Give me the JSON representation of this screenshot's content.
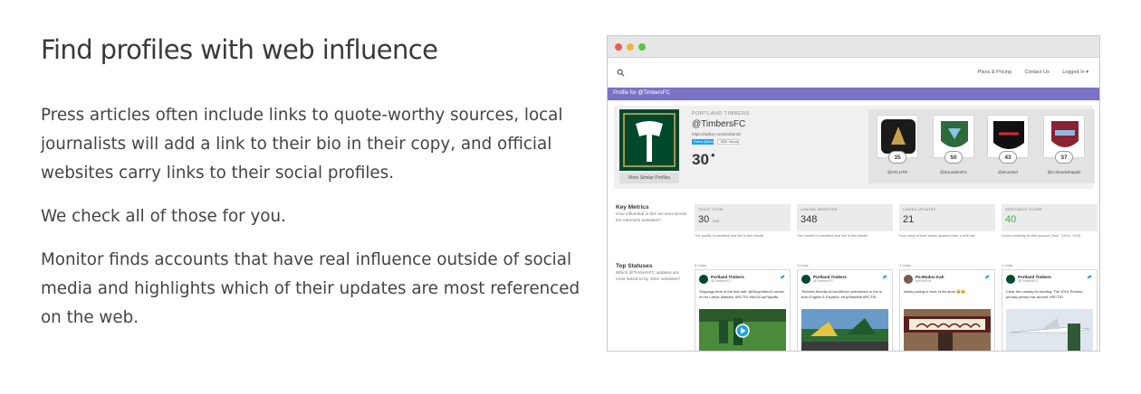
{
  "intro": {
    "title": "Find profiles with web influence",
    "paragraphs": [
      "Press articles often include links to quote-worthy sources, local journalists will add a link to their bio in their copy, and official websites carry links to their social profiles.",
      "We check all of those for you.",
      "Monitor finds accounts that have real influence outside of social media and highlights which of their updates are most referenced on the web."
    ]
  },
  "app": {
    "nav": {
      "plans": "Plans & Pricing",
      "contact": "Contact Us",
      "login": "Logged In ▾"
    },
    "profile_bar": "Profile for @TimbersFC",
    "profile": {
      "team": "PORTLAND TIMBERS",
      "handle": "@TimbersFC",
      "url": "https://twitter.com/timbersfc",
      "follow_btn": "Follow @timbersfc",
      "followers_btn": "353K followers",
      "score": "30",
      "more_similar": "More Similar Profiles"
    },
    "similar": [
      {
        "score": "35",
        "name": "@ATLUTD",
        "color": "#1a1a1a"
      },
      {
        "score": "50",
        "name": "@SoundersFC",
        "color": "#2f6b3a"
      },
      {
        "score": "43",
        "name": "@dcunited",
        "color": "#111111"
      },
      {
        "score": "37",
        "name": "@ColoradoRapids",
        "color": "#8a2432"
      }
    ],
    "key_metrics": {
      "title": "Key Metrics",
      "desc": "How influential is this account across the internet's websites?",
      "items": [
        {
          "label": "TRUST FLOW",
          "value": "30",
          "suffix": "/100",
          "caption": "The quality of websites that link to this handle"
        },
        {
          "label": "LINKING WEBSITES",
          "value": "348",
          "suffix": "",
          "caption": "The number of websites that link to this handle"
        },
        {
          "label": "LINKED UPDATES",
          "value": "21",
          "suffix": "",
          "caption": "How many of their status updates have a web link"
        },
        {
          "label": "SENTIMENT SCORE",
          "value": "40",
          "suffix": "",
          "caption": "Online positivity for this account (from -100 to +100)"
        }
      ]
    },
    "top_statuses": {
      "title": "Top Statuses",
      "desc": "Which @TimbersFC updates are most linked-to by other websites?",
      "items": [
        {
          "links": "3 Links",
          "name": "Portland Timbers",
          "handle": "@TimbersFC",
          "text": "Stoppage time of the first half. @DiegoValeri4 comes on for Larrys Mabiala. #RCTID #MLSCupPlayoffs"
        },
        {
          "links": "1 Links",
          "name": "Portland Timbers",
          "handle": "@TimbersFC",
          "text": "Timbers-Morelia #ConoWinter webstream is live in both English & Español: bit.ly/Nab568 #RCTID"
        },
        {
          "links": "1 Links",
          "name": "Pa-Modou Kah",
          "handle": "@PMKAH",
          "text": "Abuts posing in front of his store 😀😀"
        },
        {
          "links": "1 Links",
          "name": "Portland Timbers",
          "handle": "@TimbersFC",
          "text": "Clear the runway for landing. The 2015 Timbers primary jersey has arrived. #RCTID"
        }
      ]
    }
  }
}
